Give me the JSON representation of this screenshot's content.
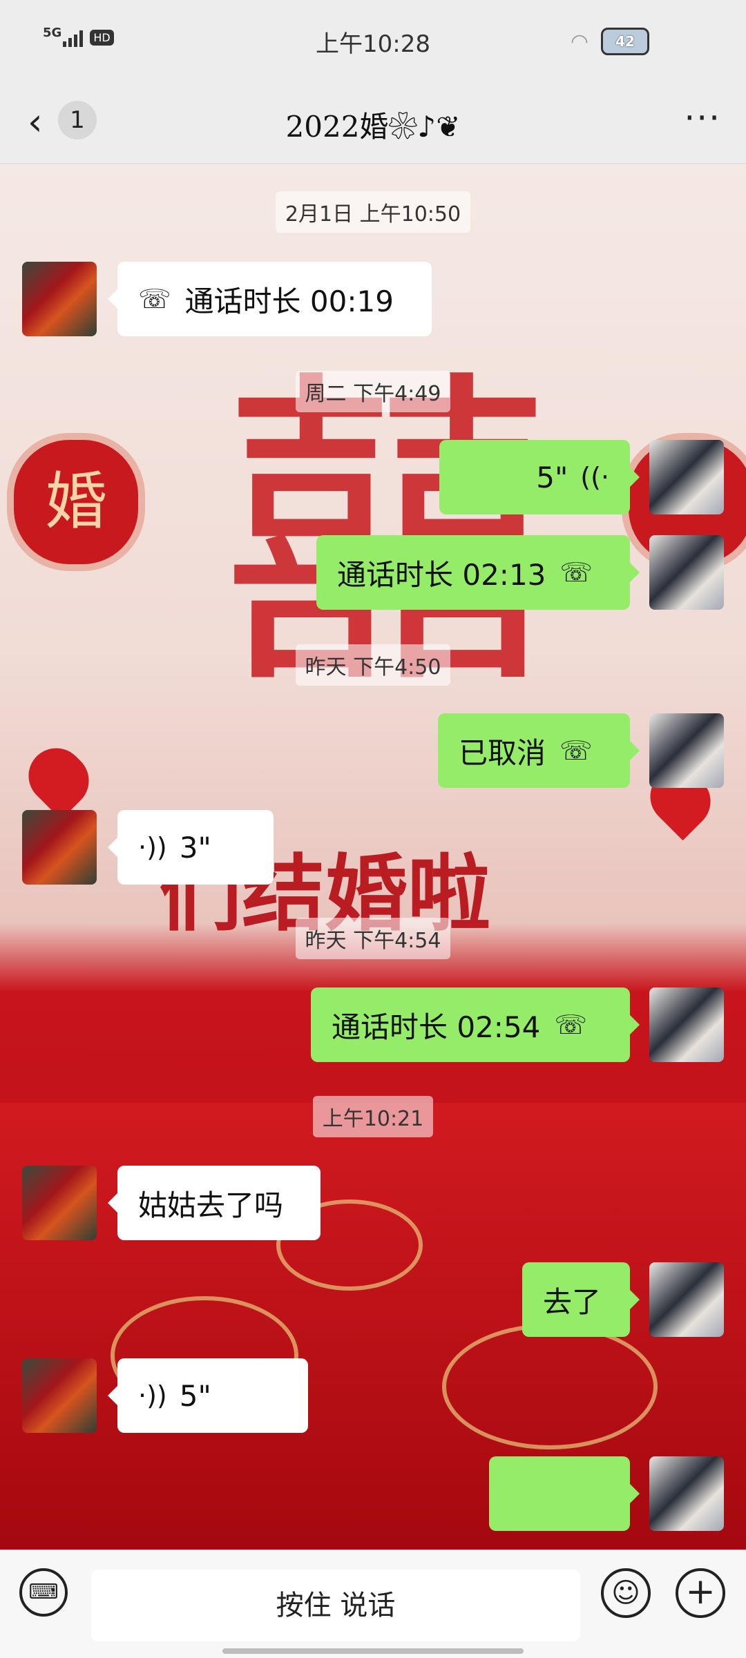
{
  "status_bar": {
    "network": "5G",
    "hd": "HD",
    "time": "上午10:28",
    "battery": "42"
  },
  "nav": {
    "back_icon": "chevron-left-icon",
    "unread": "1",
    "title": "2022婚❀♪❦",
    "more_icon": "more-icon"
  },
  "messages": [
    {
      "type": "timestamp",
      "text": "2月1日 上午10:50"
    },
    {
      "type": "call",
      "side": "left",
      "icon": "phone-icon",
      "text": "通话时长 00:19"
    },
    {
      "type": "timestamp",
      "text": "周二 下午4:49"
    },
    {
      "type": "voice",
      "side": "right",
      "icon": "voice-icon",
      "text": "5\""
    },
    {
      "type": "call",
      "side": "right",
      "icon": "phone-icon",
      "text": "通话时长 02:13"
    },
    {
      "type": "timestamp",
      "text": "昨天 下午4:50"
    },
    {
      "type": "call",
      "side": "right",
      "icon": "phone-icon",
      "text": "已取消"
    },
    {
      "type": "voice",
      "side": "left",
      "icon": "voice-icon",
      "text": "3\""
    },
    {
      "type": "timestamp",
      "text": "昨天 下午4:54"
    },
    {
      "type": "call",
      "side": "right",
      "icon": "phone-icon",
      "text": "通话时长 02:54"
    },
    {
      "type": "timestamp",
      "text": "上午10:21"
    },
    {
      "type": "text",
      "side": "left",
      "text": "姑姑去了吗"
    },
    {
      "type": "text",
      "side": "right",
      "text": "去了"
    },
    {
      "type": "voice",
      "side": "left",
      "icon": "voice-icon",
      "text": "5\""
    },
    {
      "type": "text",
      "side": "right",
      "text": ""
    }
  ],
  "background": {
    "xi_char": "囍",
    "lantern_char_left": "婚",
    "banner_text": "们结婚啦"
  },
  "input_bar": {
    "keyboard_icon": "keyboard-icon",
    "hold_to_talk": "按住 说话",
    "emoji_icon": "emoji-icon",
    "plus_icon": "plus-icon"
  }
}
